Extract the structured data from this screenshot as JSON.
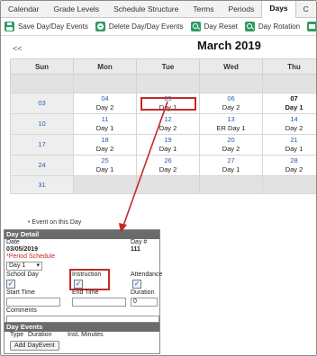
{
  "tabs": [
    "Calendar",
    "Grade Levels",
    "Schedule Structure",
    "Terms",
    "Periods",
    "Days",
    "C"
  ],
  "active_tab": "Days",
  "toolbar": {
    "save": "Save Day/Day Events",
    "delete": "Delete Day/Day Events",
    "reset": "Day Reset",
    "rotation": "Day Rotation"
  },
  "calendar": {
    "prev": "<<",
    "month": "March 2019",
    "headers": [
      "Sun",
      "Mon",
      "Tue",
      "Wed",
      "Thu"
    ],
    "weeks": [
      {
        "sun": "",
        "days": []
      },
      {
        "sun": "03",
        "days": [
          [
            "04",
            "Day 2"
          ],
          [
            "05",
            "Day 1"
          ],
          [
            "06",
            "Day 2"
          ],
          [
            "07",
            "Day 1"
          ]
        ]
      },
      {
        "sun": "10",
        "days": [
          [
            "11",
            "Day 1"
          ],
          [
            "12",
            "Day 2"
          ],
          [
            "13",
            "ER Day 1"
          ],
          [
            "14",
            "Day 2"
          ]
        ]
      },
      {
        "sun": "17",
        "days": [
          [
            "18",
            "Day 2"
          ],
          [
            "19",
            "Day 1"
          ],
          [
            "20",
            "Day 2"
          ],
          [
            "21",
            "Day 1"
          ]
        ]
      },
      {
        "sun": "24",
        "days": [
          [
            "25",
            "Day 1"
          ],
          [
            "26",
            "Day 2"
          ],
          [
            "27",
            "Day 1"
          ],
          [
            "28",
            "Day 2"
          ]
        ]
      },
      {
        "sun": "31",
        "days": []
      }
    ],
    "legend": "Event on this Day"
  },
  "detail": {
    "title": "Day Detail",
    "date_label": "Date",
    "date_value": "03/05/2019",
    "daynum_label": "Day #",
    "daynum_value": "111",
    "period_schedule_label": "*Period Schedule",
    "period_schedule_value": "Day 1",
    "school_day_label": "School Day",
    "instruction_label": "Instruction",
    "attendance_label": "Attendance",
    "start_time_label": "Start Time",
    "end_time_label": "End Time",
    "duration_label": "Duration",
    "duration_value": "0",
    "comments_label": "Comments"
  },
  "events": {
    "title": "Day Events",
    "col_type": "Type",
    "col_duration": "Duration",
    "col_minutes": "Inst. Minutes",
    "add_button": "Add DayEvent"
  },
  "colors": {
    "accent_green": "#2e9b63",
    "link_blue": "#2a5db0",
    "highlight_red": "#c42a2a",
    "panel_header": "#6b6b6b"
  }
}
